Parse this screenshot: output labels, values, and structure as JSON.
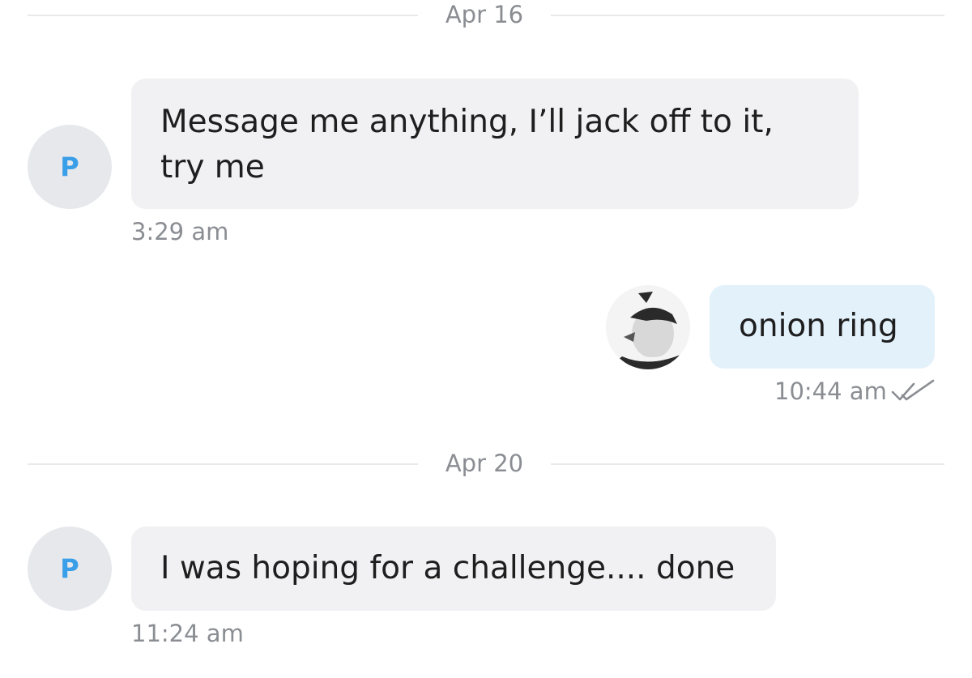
{
  "separators": [
    {
      "label": "Apr 16"
    },
    {
      "label": "Apr 20"
    }
  ],
  "messages": [
    {
      "sender_initial": "P",
      "text_line1": "Message me anything, I’ll jack off to it,",
      "text_line2": "try me",
      "time": "3:29 am",
      "direction": "incoming"
    },
    {
      "text": "onion ring",
      "time": "10:44 am",
      "direction": "outgoing",
      "status_icon": "double-check-icon"
    },
    {
      "sender_initial": "P",
      "text": "I was hoping for a challenge.... done",
      "time": "11:24 am",
      "direction": "incoming"
    }
  ],
  "colors": {
    "incoming_bubble": "#f1f1f3",
    "outgoing_bubble": "#e3f1fb",
    "avatar_letter": "#3a9ee8",
    "meta_text": "#8a8d92"
  }
}
